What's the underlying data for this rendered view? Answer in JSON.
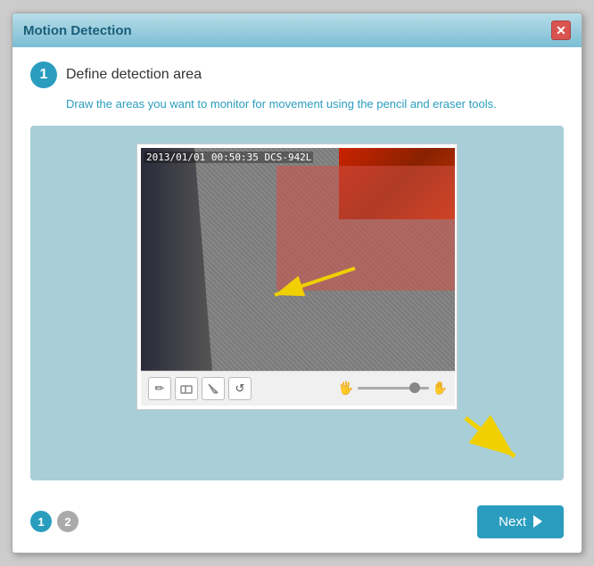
{
  "dialog": {
    "title": "Motion Detection",
    "close_label": "✕"
  },
  "step1": {
    "number": "1",
    "title": "Define detection area",
    "description": "Draw the areas you want to monitor for movement using the pencil and eraser tools."
  },
  "camera": {
    "timestamp": "2013/01/01 00:50:35 DCS-942L"
  },
  "toolbar": {
    "pencil_label": "✏",
    "eraser_label": "◈",
    "brush_label": "✦",
    "refresh_label": "↺"
  },
  "footer": {
    "step1_label": "1",
    "step2_label": "2",
    "next_label": "Next"
  }
}
